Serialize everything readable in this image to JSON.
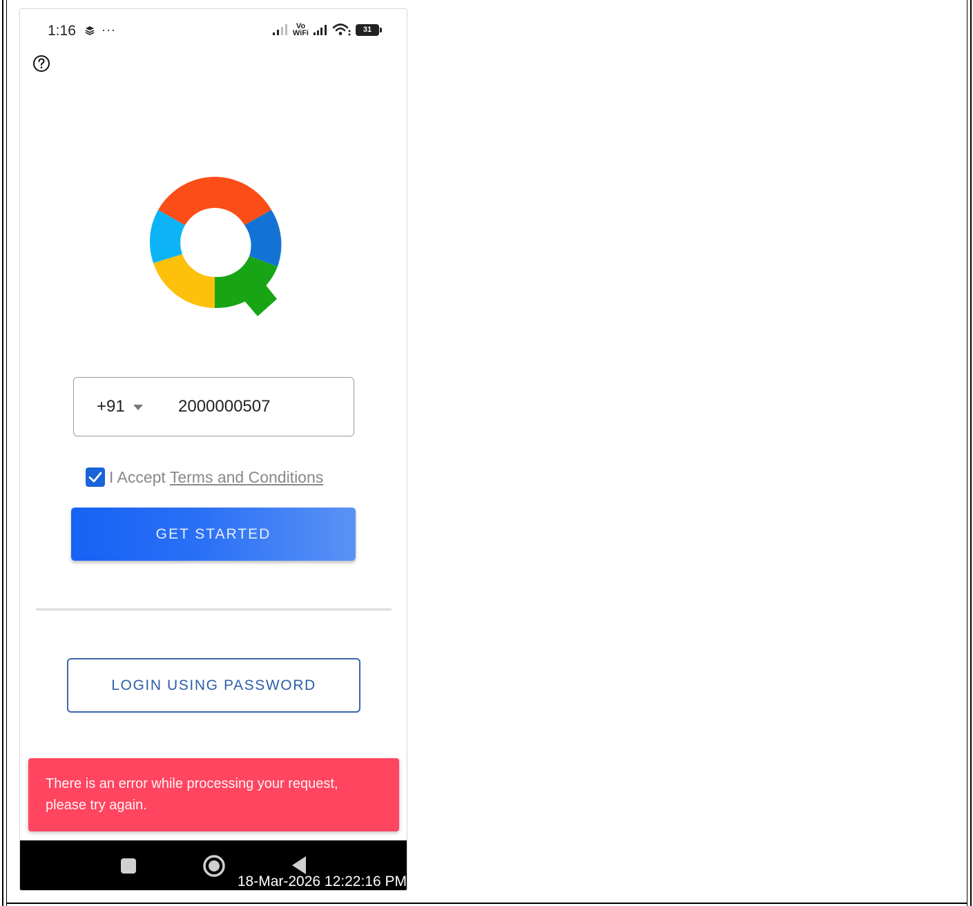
{
  "status_bar": {
    "time": "1:16",
    "left_icons": [
      "layers-icon",
      "more-dots-icon"
    ],
    "more_glyph": "···",
    "vowifi_top": "Vo",
    "vowifi_bottom": "WiFi",
    "battery": "31",
    "right_icons": [
      "signal-icon",
      "vowifi-icon",
      "signal-icon",
      "wifi-icon",
      "battery-icon"
    ]
  },
  "header": {
    "help_icon": "help-circle-icon"
  },
  "logo": {
    "name": "q-logo",
    "colors": [
      "#fb4d17",
      "#1373d4",
      "#17a516",
      "#fdc10b",
      "#0db4f5"
    ]
  },
  "login_form": {
    "country_code": "+91",
    "phone_number": "2000000507",
    "terms_prefix": "I Accept",
    "terms_link": "Terms and Conditions",
    "terms_checked": true,
    "get_started_label": "GET STARTED",
    "login_password_label": "LOGIN USING PASSWORD"
  },
  "error_toast": {
    "line1": "There is an error while processing your request,",
    "line2": "please try again."
  },
  "nav_bar": {
    "icons": [
      "recents-icon",
      "home-icon",
      "back-icon"
    ]
  },
  "timestamp": "18-Mar-2026 12:22:16 PM",
  "colors": {
    "primary": "#1762f5",
    "outline_button": "#2b5ea8",
    "error": "#ff4560",
    "checkbox": "#1a63d8"
  }
}
